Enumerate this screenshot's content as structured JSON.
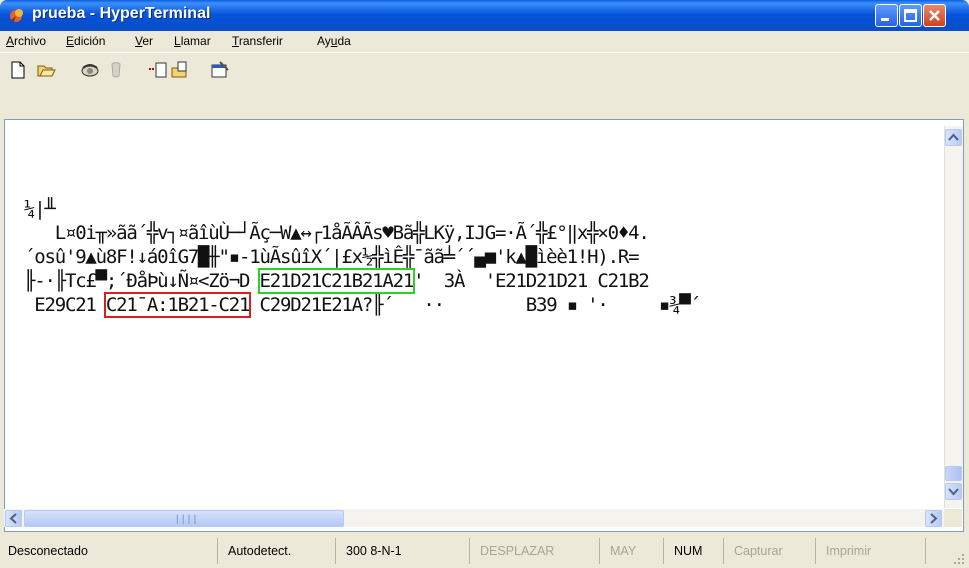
{
  "window": {
    "title": "prueba - HyperTerminal"
  },
  "menu": {
    "items": [
      {
        "accel": "A",
        "rest": "rchivo"
      },
      {
        "accel": "E",
        "rest": "dición"
      },
      {
        "accel": "V",
        "rest": "er"
      },
      {
        "accel": "L",
        "rest": "lamar"
      },
      {
        "accel": "T",
        "rest": "ransferir"
      },
      {
        "pre": "Ay",
        "accel": "u",
        "rest": "da"
      }
    ]
  },
  "toolbar": {
    "icons": [
      "new-icon",
      "open-icon",
      "connect-icon",
      "disconnect-icon",
      "send-icon",
      "receive-icon",
      "properties-icon"
    ]
  },
  "terminal": {
    "line1": "¼|╨",
    "line2_pre": "   L¤0i╥»ãã´╬v┐¤ãîùÙ─┘Ãç─W▲↔┌1åÃÂÃs♥Bã╬LKÿ,IJG=·Ã´╬£°‖x╬×0♦4.",
    "line3": "´osû'9▲ù8F!↓á0îG7█╫\"▪-1ùÃsûîX´|£x½╬ìÊ╬¯ãã╧´´▄■'k▲█ìèè1!H).R=",
    "line4_pre": "╟-·╟Tc£▀;´ÐåÞù↓Ñ¤<Zö¬D ",
    "line4_green": "E21D21C21B21A21",
    "line4_post": "'  3À  'E21D21D21 C21B2",
    "line5_pre": " E29C21 ",
    "line5_red": "C21¯A:1B21-C21",
    "line5_post": " C29D21E21A?╟´   ··        B39 ▪ '·     ▪¾▀´"
  },
  "status": {
    "connection": "Desconectado",
    "emulation": "Autodetect.",
    "port_settings": "300 8-N-1",
    "scroll": "DESPLAZAR",
    "caps": "MAY",
    "num": "NUM",
    "capture": "Capturar",
    "print": "Imprimir"
  }
}
